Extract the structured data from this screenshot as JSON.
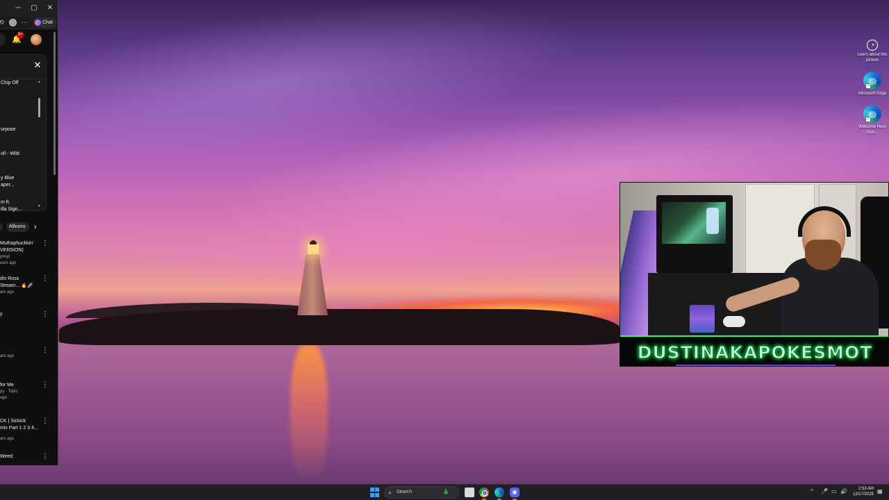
{
  "desktop": {
    "icons": [
      {
        "label": "Learn about this picture",
        "icon": "learn-about-picture-icon"
      },
      {
        "label": "Microsoft Edge",
        "icon": "edge-icon"
      },
      {
        "label": "Welcome Here Dus...",
        "icon": "edge-shortcut-icon"
      }
    ]
  },
  "browser": {
    "titlebar": {
      "minimize": "─",
      "maximize": "▢",
      "close": "✕"
    },
    "toolbar": {
      "menu_dots": "···",
      "chat_label": "Chat"
    },
    "header": {
      "notification_count": "9+"
    },
    "queue": {
      "close_glyph": "✕",
      "items": [
        "Chip Off",
        "urpose",
        "oll - Wild",
        "y Blue",
        "aper...",
        "m ft.",
        "illa Sign..."
      ]
    },
    "chips": {
      "albums": "Albums",
      "next_glyph": "›"
    },
    "recommendations": [
      {
        "title1": "Muthaphuckkin'",
        "title2": "VERSION)",
        "meta1": "pHop",
        "meta2": "ears ago"
      },
      {
        "title1": "din Ross",
        "title2": "Stream... 🔥🚀",
        "meta1": "",
        "meta2": "ars ago"
      },
      {
        "title1": "y",
        "title2": "",
        "meta1": "",
        "meta2": ""
      },
      {
        "title1": "",
        "title2": "",
        "meta1": "",
        "meta2": "ars ago"
      },
      {
        "title1": "for Me",
        "title2": "",
        "meta1": "py · Topic",
        "meta2": "ago"
      },
      {
        "title1": "CK | Sickick",
        "title2": "mix Part 1 2 3 4...",
        "meta1": "",
        "meta2": "ars ago"
      },
      {
        "title1": "Weed",
        "title2": "",
        "meta1": "",
        "meta2": ""
      }
    ]
  },
  "webcam": {
    "banner_text": "DUSTINAKAPOKESMOT"
  },
  "taskbar": {
    "search_label": "Search",
    "clock_time": "2:53 AM",
    "clock_date": "12/17/2025",
    "tray": [
      "^",
      "🎤",
      "▭",
      "🔊",
      "▦"
    ]
  }
}
